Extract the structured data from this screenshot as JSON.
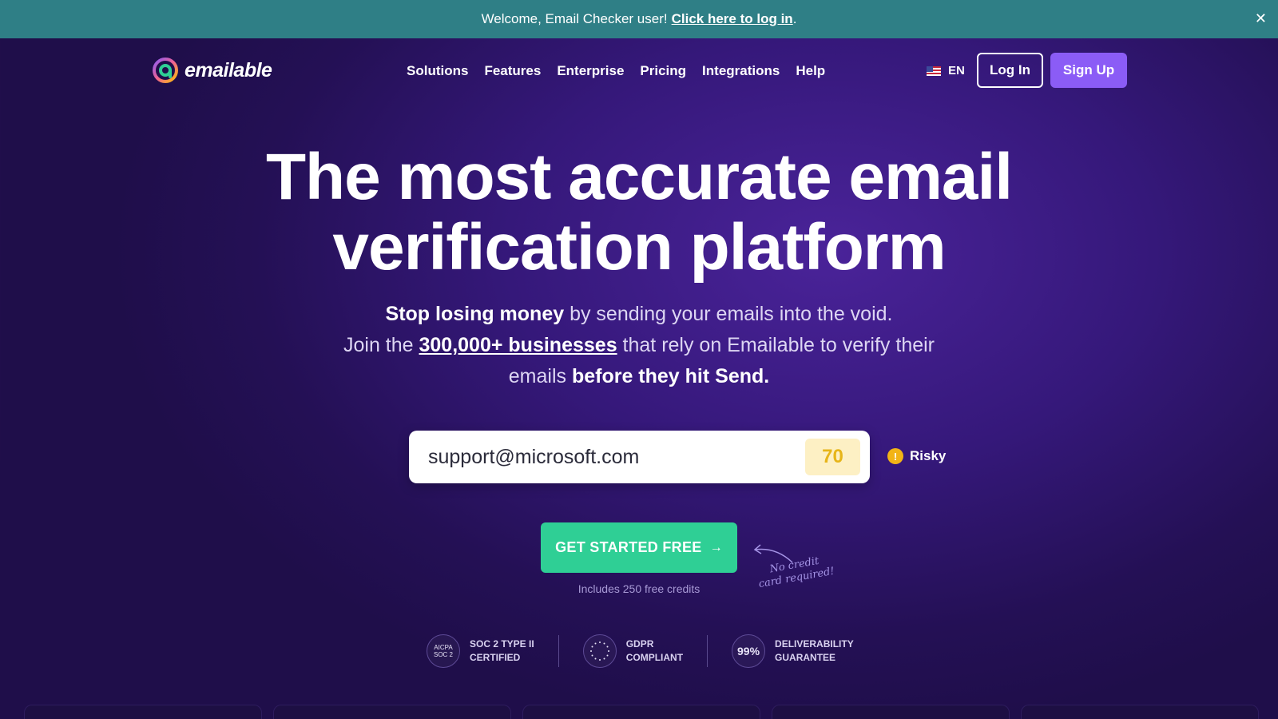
{
  "banner": {
    "text": "Welcome, Email Checker user!",
    "link": "Click here to log in",
    "suffix": ".",
    "close_icon": "close-icon"
  },
  "nav": {
    "logo_text": "emailable",
    "menu": [
      "Solutions",
      "Features",
      "Enterprise",
      "Pricing",
      "Integrations",
      "Help"
    ],
    "language": "EN",
    "login": "Log In",
    "signup": "Sign Up"
  },
  "hero": {
    "title_line1": "The most accurate email",
    "title_line2": "verification platform",
    "sub_bold1": "Stop losing money",
    "sub_text1": " by sending your emails into the void.",
    "sub_text2": "Join the ",
    "sub_link": "300,000+ businesses",
    "sub_text3": " that rely on Emailable to verify their emails ",
    "sub_bold2": "before they hit Send."
  },
  "checker": {
    "email_value": "support@microsoft.com",
    "score": "70",
    "status": "Risky",
    "status_icon": "!"
  },
  "cta": {
    "label": "GET STARTED FREE",
    "arrow": "→",
    "note": "Includes 250 free credits",
    "handwritten_line1": "No credit",
    "handwritten_line2": "card required!"
  },
  "badges": [
    {
      "icon_line1": "AICPA",
      "icon_line2": "SOC 2",
      "line1": "SOC 2 TYPE II",
      "line2": "CERTIFIED"
    },
    {
      "icon_line1": "",
      "icon_line2": "",
      "line1": "GDPR",
      "line2": "COMPLIANT"
    },
    {
      "icon_line1": "99%",
      "icon_line2": "",
      "line1": "DELIVERABILITY",
      "line2": "GUARANTEE"
    }
  ],
  "colors": {
    "banner": "#2f7f86",
    "accent_purple": "#8b5cf6",
    "cta_green": "#2fcf95",
    "score_yellow": "#e7b519",
    "risky_dot": "#f2b416"
  }
}
